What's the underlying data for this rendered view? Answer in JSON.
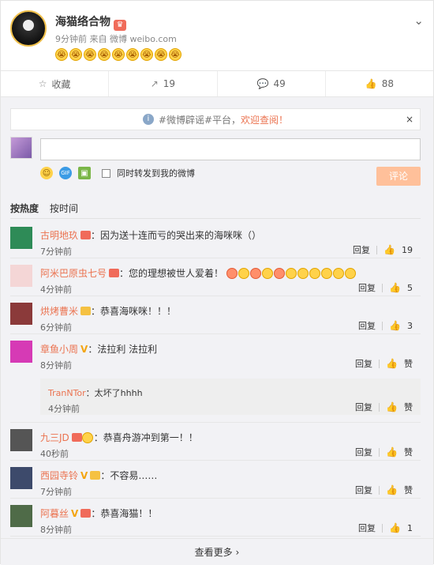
{
  "post": {
    "author": "海猫络合物",
    "meta": "9分钟前 来自 微博 weibo.com",
    "emoji_count": 9
  },
  "actions": [
    {
      "icon": "star-icon",
      "label": "收藏"
    },
    {
      "icon": "share-icon",
      "label": "19"
    },
    {
      "icon": "comment-icon",
      "label": "49"
    },
    {
      "icon": "like-icon",
      "label": "88"
    }
  ],
  "notice": {
    "prefix": "#微博辟谣#平台，",
    "highlight": "欢迎查阅！",
    "close": "×"
  },
  "composer": {
    "placeholder": "",
    "repost_label": "同时转发到我的微博",
    "submit_label": "评论"
  },
  "sort": {
    "active": "按热度",
    "other": "按时间"
  },
  "comments": [
    {
      "user": "古明地玖",
      "badge": "vip",
      "text": "：因为送十连而亏的哭出来的海咪咪（）",
      "time": "7分钟前",
      "reply": "回复",
      "likes": "19",
      "color": "#2e8b57",
      "height": 48
    },
    {
      "user": "阿米巴原虫七号",
      "badge": "vip",
      "text": "：您的理想被世人爱着！",
      "emojis": 11,
      "time": "4分钟前",
      "reply": "回复",
      "likes": "5",
      "color": "#e6a5a5",
      "height": 48
    },
    {
      "user": "烘烤曹米",
      "badge": "yellow",
      "text": "：恭喜海咪咪！！！",
      "time": "6分钟前",
      "reply": "回复",
      "likes": "3",
      "color": "#8b3a3a",
      "height": 48
    },
    {
      "user": "章鱼小周",
      "badge": "v",
      "text": "：法拉利 法拉利",
      "time": "8分钟前",
      "reply": "回复",
      "likes": "赞",
      "color": "#d63ab5",
      "height": 112,
      "sub": {
        "user": "TranNTor",
        "text": "：太坏了hhhh",
        "time": "4分钟前",
        "reply": "回复",
        "likes": "赞"
      }
    },
    {
      "user": "九三JD",
      "badge": "vip",
      "text": "：恭喜舟游冲到第一！！",
      "time": "40秒前",
      "reply": "回复",
      "likes": "赞",
      "color": "#555555",
      "height": 48
    },
    {
      "user": "西园寺铃",
      "badge": "v",
      "text": "：不容易……",
      "time": "7分钟前",
      "reply": "回复",
      "likes": "赞",
      "color": "#3d4a6b",
      "height": 48
    },
    {
      "user": "阿暮丝",
      "badge": "v",
      "text": "：恭喜海猫！！",
      "time": "8分钟前",
      "reply": "回复",
      "likes": "1",
      "color": "#4f6b48",
      "height": 48
    }
  ],
  "more_label": "查看更多",
  "colors": {
    "accent": "#eb7350",
    "username": "#eb7350",
    "submit": "#ffc09a"
  }
}
